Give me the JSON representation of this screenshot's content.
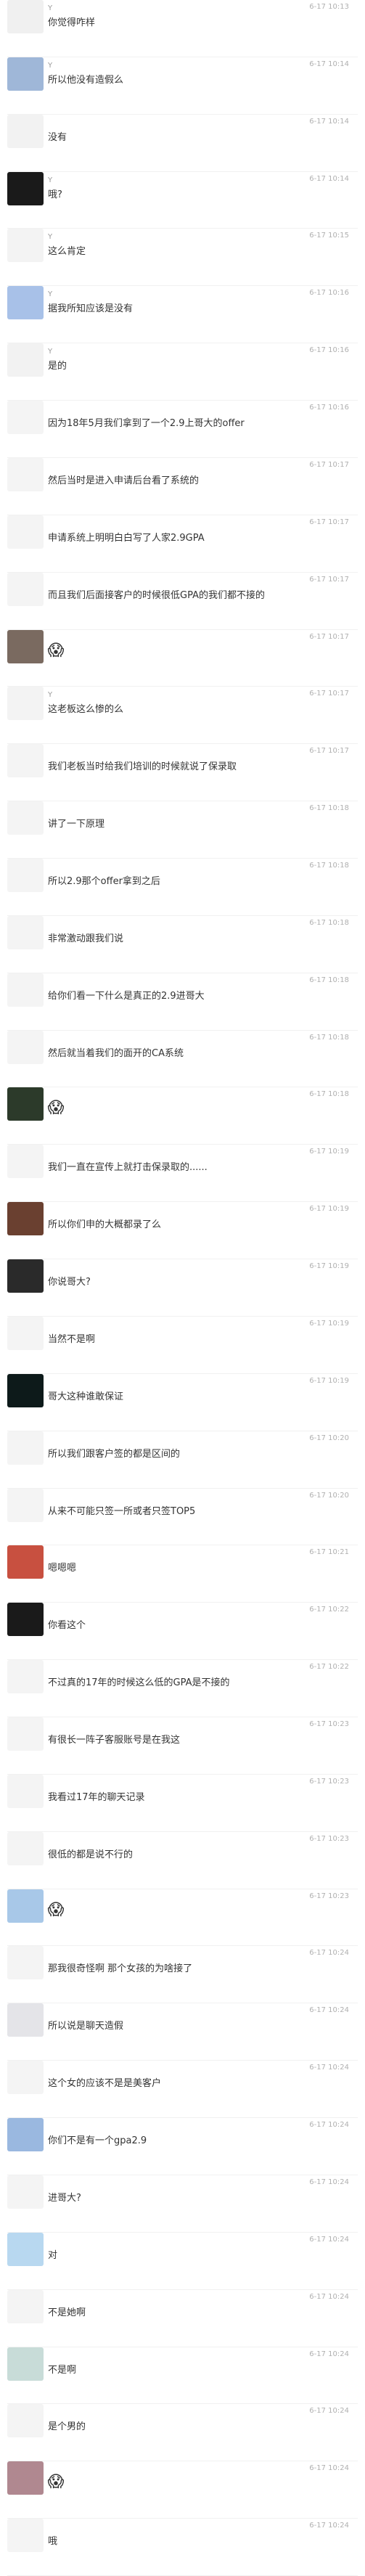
{
  "messages": [
    {
      "name": "Y",
      "time": "6-17 10:13",
      "text": "你觉得咋样",
      "avatar_color": "#f0f0f0"
    },
    {
      "name": "Y",
      "time": "6-17 10:14",
      "text": "所以他没有造假么",
      "avatar_color": "#9fb7d8"
    },
    {
      "name": "",
      "time": "6-17 10:14",
      "text": "没有",
      "avatar_color": "#f2f2f2"
    },
    {
      "name": "Y",
      "time": "6-17 10:14",
      "text": "哦?",
      "avatar_color": "#1a1a1a"
    },
    {
      "name": "Y",
      "time": "6-17 10:15",
      "text": "这么肯定",
      "avatar_color": "#f3f3f3"
    },
    {
      "name": "Y",
      "time": "6-17 10:16",
      "text": "据我所知应该是没有",
      "avatar_color": "#a8c1e8"
    },
    {
      "name": "Y",
      "time": "6-17 10:16",
      "text": "是的",
      "avatar_color": "#f2f2f2"
    },
    {
      "name": "",
      "time": "6-17 10:16",
      "text": "因为18年5月我们拿到了一个2.9上哥大的offer",
      "avatar_color": "#f4f4f4"
    },
    {
      "name": "",
      "time": "6-17 10:17",
      "text": "然后当时是进入申请后台看了系统的",
      "avatar_color": "#f4f4f4"
    },
    {
      "name": "",
      "time": "6-17 10:17",
      "text": "申请系统上明明白白写了人家2.9GPA",
      "avatar_color": "#f4f4f4"
    },
    {
      "name": "",
      "time": "6-17 10:17",
      "text": "而且我们后面接客户的时候很低GPA的我们都不接的",
      "avatar_color": "#f4f4f4"
    },
    {
      "name": "",
      "time": "6-17 10:17",
      "text": "😱",
      "emoji": true,
      "avatar_color": "#7a6a60"
    },
    {
      "name": "Y",
      "time": "6-17 10:17",
      "text": "这老板这么惨的么",
      "avatar_color": "#f3f3f3"
    },
    {
      "name": "",
      "time": "6-17 10:17",
      "text": "我们老板当时给我们培训的时候就说了保录取",
      "avatar_color": "#f4f4f4"
    },
    {
      "name": "",
      "time": "6-17 10:18",
      "text": "讲了一下原理",
      "avatar_color": "#f4f4f4"
    },
    {
      "name": "",
      "time": "6-17 10:18",
      "text": "所以2.9那个offer拿到之后",
      "avatar_color": "#f4f4f4"
    },
    {
      "name": "",
      "time": "6-17 10:18",
      "text": "非常激动跟我们说",
      "avatar_color": "#f4f4f4"
    },
    {
      "name": "",
      "time": "6-17 10:18",
      "text": "给你们看一下什么是真正的2.9进哥大",
      "avatar_color": "#f4f4f4"
    },
    {
      "name": "",
      "time": "6-17 10:18",
      "text": "然后就当着我们的面开的CA系统",
      "avatar_color": "#f4f4f4"
    },
    {
      "name": "",
      "time": "6-17 10:18",
      "text": "😱",
      "emoji": true,
      "avatar_color": "#2c3a2a"
    },
    {
      "name": "",
      "time": "6-17 10:19",
      "text": "我们一直在宣传上就打击保录取的......",
      "avatar_color": "#f4f4f4"
    },
    {
      "name": "",
      "time": "6-17 10:19",
      "text": "所以你们申的大概都录了么",
      "avatar_color": "#6a4030"
    },
    {
      "name": "",
      "time": "6-17 10:19",
      "text": "你说哥大?",
      "avatar_color": "#2a2a2a"
    },
    {
      "name": "",
      "time": "6-17 10:19",
      "text": "当然不是啊",
      "avatar_color": "#f4f4f4"
    },
    {
      "name": "",
      "time": "6-17 10:19",
      "text": "哥大这种谁敢保证",
      "avatar_color": "#0d1a1a"
    },
    {
      "name": "",
      "time": "6-17 10:20",
      "text": "所以我们跟客户签的都是区间的",
      "avatar_color": "#f4f4f4"
    },
    {
      "name": "",
      "time": "6-17 10:20",
      "text": "从来不可能只签一所或者只签TOP5",
      "avatar_color": "#f4f4f4"
    },
    {
      "name": "",
      "time": "6-17 10:21",
      "text": "嗯嗯嗯",
      "avatar_color": "#c85040"
    },
    {
      "name": "",
      "time": "6-17 10:22",
      "text": "你看这个",
      "avatar_color": "#1a1a1a"
    },
    {
      "name": "",
      "time": "6-17 10:22",
      "text": "不过真的17年的时候这么低的GPA是不接的",
      "avatar_color": "#f4f4f4"
    },
    {
      "name": "",
      "time": "6-17 10:23",
      "text": "有很长一阵子客服账号是在我这",
      "avatar_color": "#f4f4f4"
    },
    {
      "name": "",
      "time": "6-17 10:23",
      "text": "我看过17年的聊天记录",
      "avatar_color": "#f4f4f4"
    },
    {
      "name": "",
      "time": "6-17 10:23",
      "text": "很低的都是说不行的",
      "avatar_color": "#f4f4f4"
    },
    {
      "name": "",
      "time": "6-17 10:23",
      "text": "😱",
      "emoji": true,
      "avatar_color": "#a8c8e8"
    },
    {
      "name": "",
      "time": "6-17 10:24",
      "text": "那我很奇怪啊 那个女孩的为啥接了",
      "avatar_color": "#f4f4f4"
    },
    {
      "name": "",
      "time": "6-17 10:24",
      "text": "所以说是聊天造假",
      "avatar_color": "#e4e4e8"
    },
    {
      "name": "",
      "time": "6-17 10:24",
      "text": "这个女的应该不是是美客户",
      "avatar_color": "#f4f4f4"
    },
    {
      "name": "",
      "time": "6-17 10:24",
      "text": "你们不是有一个gpa2.9",
      "avatar_color": "#9ab8e0"
    },
    {
      "name": "",
      "time": "6-17 10:24",
      "text": "进哥大?",
      "avatar_color": "#f4f4f4"
    },
    {
      "name": "",
      "time": "6-17 10:24",
      "text": "对",
      "avatar_color": "#b8d8f0"
    },
    {
      "name": "",
      "time": "6-17 10:24",
      "text": "不是她啊",
      "avatar_color": "#f4f4f4"
    },
    {
      "name": "",
      "time": "6-17 10:24",
      "text": "不是啊",
      "avatar_color": "#c8dcd8"
    },
    {
      "name": "",
      "time": "6-17 10:24",
      "text": "是个男的",
      "avatar_color": "#f4f4f4"
    },
    {
      "name": "",
      "time": "6-17 10:24",
      "text": "😱",
      "emoji": true,
      "avatar_color": "#b08890"
    },
    {
      "name": "",
      "time": "6-17 10:24",
      "text": "哦",
      "avatar_color": "#f4f4f4"
    }
  ]
}
